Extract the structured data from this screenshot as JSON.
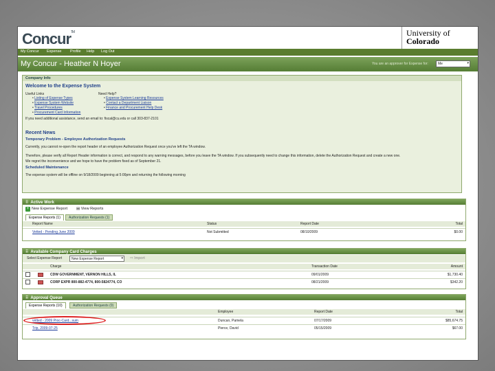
{
  "app": {
    "logo": "Concur",
    "logo_tm": "TM",
    "university_line1": "University of",
    "university_line2": "Colorado"
  },
  "nav": [
    "My Concur",
    "Expense",
    "Profile",
    "Help",
    "Log Out"
  ],
  "title": {
    "text": "My Concur - Heather N Hoyer",
    "approver_label": "You are an approver for Expense for:",
    "approver_value": "Me"
  },
  "company_info": {
    "header": "Company Info",
    "welcome": "Welcome to the Expense System",
    "useful_links_label": "Useful Links",
    "useful_links": [
      "Listing of Expense Types",
      "Expense System Website",
      "Travel Procedures",
      "Procurement Card Information"
    ],
    "need_help_label": "Need Help?",
    "need_help_links": [
      "Expense System Learning Resources",
      "Contact a Department Liaison",
      "Finance and Procurement Help Desk"
    ],
    "assist_text": "If you need additional assistance, send an email to: fiscal@cu.edu or call 303-837-2101",
    "recent_news_title": "Recent News",
    "news_heading": "Temporary Problem - Employee Authorization Requests",
    "news_p1": "Currently, you cannot re-open the report header of an employee Authorization Request once you've left the TA window.",
    "news_p2": "Therefore, please verify all Report Header information is correct, and respond to any warning messages, before you leave the TA window. If you subsequently need to change this information, delete the Authorization Request and create a new one.",
    "news_p3": "We regret the inconvenience and we hope to have the problem fixed as of September 21.",
    "maint_heading": "Scheduled Maintenance",
    "maint_text": "The expense system will be offline on 9/18/2009 beginning at 5:00pm and returning the following morning"
  },
  "active_work": {
    "header": "Active Work",
    "new_report": "New Expense Report",
    "view_reports": "View Reports",
    "tabs": [
      "Expense Reports (1)",
      "Authorization Requests (1)"
    ],
    "columns": [
      "Report Name",
      "Status",
      "Report Date",
      "Total"
    ],
    "rows": [
      {
        "name": "Vetted - Pending June 2009",
        "status": "Not Submitted",
        "date": "08/10/2009",
        "total": "$0.00"
      }
    ]
  },
  "card_charges": {
    "header": "Available Company Card Charges",
    "select_label": "Select Expense Report",
    "select_value": "New Expense Report",
    "import_label": "Import",
    "columns": [
      "Charge",
      "Transaction Date",
      "Amount"
    ],
    "rows": [
      {
        "charge": "CDW GOVERNMENT, VERNON HILLS, IL",
        "date": "09/01/2009",
        "amount": "$1,730.40"
      },
      {
        "charge": "CORP EXPR 800-882-4774, 800-5824774, CO",
        "date": "08/21/2009",
        "amount": "$342.20"
      }
    ]
  },
  "approval": {
    "header": "Approval Queue",
    "tabs": [
      "Expense Reports (10)",
      "Authorization Requests (0)"
    ],
    "columns": [
      "Employee",
      "Report Date",
      "Total"
    ],
    "rows": [
      {
        "name": "vetted - 2009 Proc-Card...sum",
        "employee": "Duncan, Pamela",
        "date": "07/17/2009",
        "total": "$85,674.75"
      },
      {
        "name": "Trip, 2009-07-25",
        "employee": "Pierce, David",
        "date": "05/15/2009",
        "total": "$67.00"
      }
    ]
  },
  "colors": {
    "accent_green": "#557d35",
    "highlight_circle": "#dd2222"
  }
}
